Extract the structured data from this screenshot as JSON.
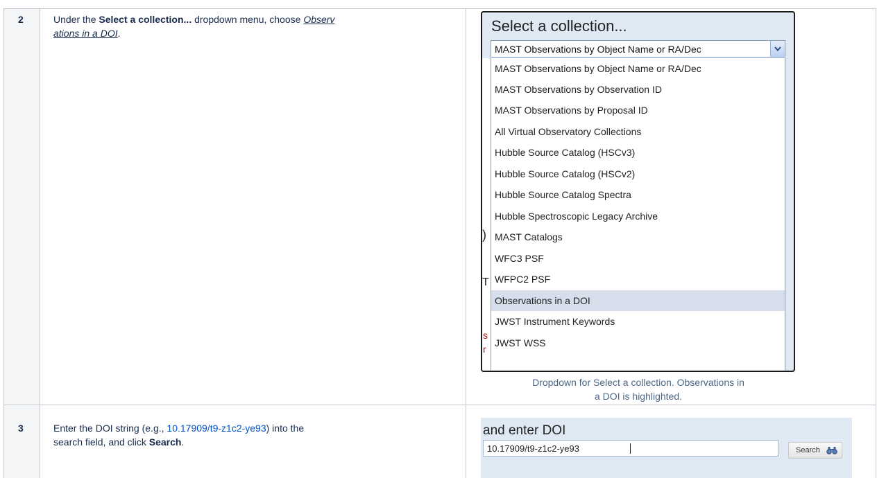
{
  "rows": [
    {
      "number": "2",
      "text_before": "Under the ",
      "bold_1": "Select a collection...",
      "text_middle": " dropdown menu, choose ",
      "underline_1": "Observ",
      "underline_2": "ations in a DOI",
      "text_end": "."
    },
    {
      "number": "3",
      "text_before": "Enter the DOI string (e.g., ",
      "link": "10.17909/t9-z1c2-ye93",
      "text_middle": ") into the",
      "text_line2": "search field, and click ",
      "bold_1": "Search",
      "text_end": "."
    }
  ],
  "dropdown_shot": {
    "title": "Select a collection...",
    "selected_value": "MAST Observations by Object Name or RA/Dec",
    "options": [
      "MAST Observations by Object Name or RA/Dec",
      "MAST Observations by Observation ID",
      "MAST Observations by Proposal ID",
      "All Virtual Observatory Collections",
      "Hubble Source Catalog (HSCv3)",
      "Hubble Source Catalog (HSCv2)",
      "Hubble Source Catalog Spectra",
      "Hubble Spectroscopic Legacy Archive",
      "MAST Catalogs",
      "WFC3 PSF",
      "WFPC2 PSF",
      "Observations in a DOI",
      "JWST Instrument Keywords",
      "JWST WSS"
    ],
    "highlighted_option": "Observations in a DOI",
    "caption_line1": "Dropdown for Select a collection. Observations in",
    "caption_line2": "a DOI is highlighted.",
    "colors": {
      "highlight": "#d5deea",
      "panel": "#dfe9f4",
      "caption": "#4a6785"
    }
  },
  "doi_shot": {
    "title": "and enter DOI",
    "input_value": "10.17909/t9-z1c2-ye93",
    "search_label": "Search",
    "search_icon": "binoculars-icon"
  },
  "colors": {
    "link": "#0052cc",
    "border": "#c1c7d0",
    "number_cell": "#f4f5f7"
  }
}
